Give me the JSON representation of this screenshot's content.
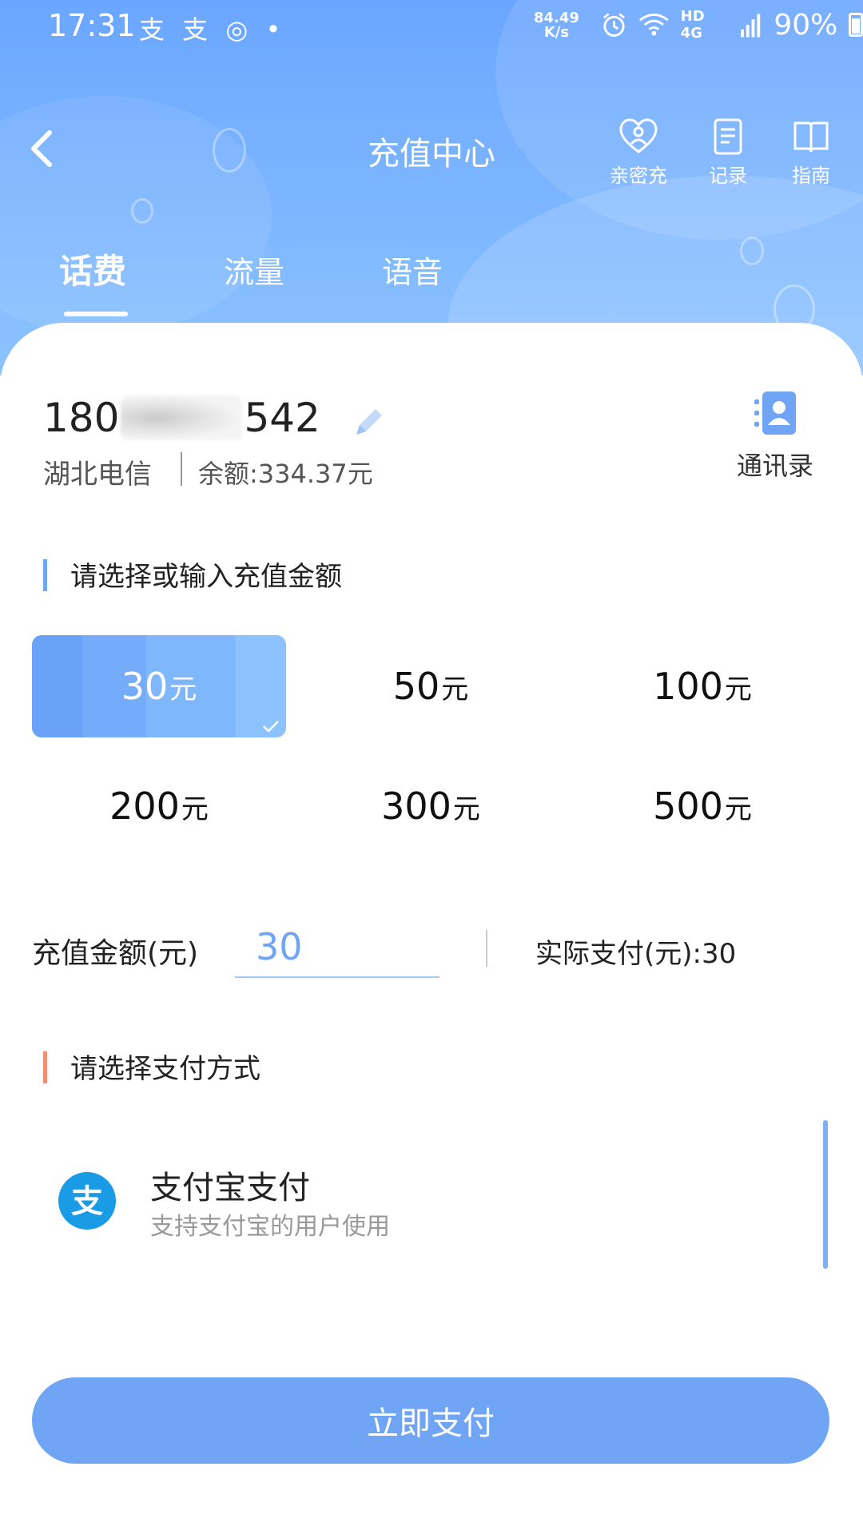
{
  "status_bar": {
    "time": "17:31",
    "app_icons": "支 支 ◎ •",
    "net_speed_value": "84.49",
    "net_speed_unit": "K/s",
    "network_label": "HD 4G",
    "battery": "90%"
  },
  "header": {
    "title": "充值中心",
    "actions": [
      {
        "label": "亲密充",
        "icon": "heart-user-icon"
      },
      {
        "label": "记录",
        "icon": "record-icon"
      },
      {
        "label": "指南",
        "icon": "book-icon"
      }
    ]
  },
  "tabs": [
    {
      "label": "话费",
      "active": true
    },
    {
      "label": "流量",
      "active": false
    },
    {
      "label": "语音",
      "active": false
    }
  ],
  "account": {
    "phone_prefix": "180",
    "phone_suffix": "542",
    "carrier": "湖北电信",
    "balance": "余额:334.37元",
    "contacts_label": "通讯录"
  },
  "amount_section": {
    "title": "请选择或输入充值金额",
    "unit": "元",
    "options": [
      {
        "value": "30",
        "selected": true
      },
      {
        "value": "50",
        "selected": false
      },
      {
        "value": "100",
        "selected": false
      },
      {
        "value": "200",
        "selected": false
      },
      {
        "value": "300",
        "selected": false
      },
      {
        "value": "500",
        "selected": false
      }
    ]
  },
  "recharge": {
    "label": "充值金额(元)",
    "value": "30",
    "actual_pay": "实际支付(元):30"
  },
  "payment_section": {
    "title": "请选择支付方式",
    "method": {
      "name": "支付宝支付",
      "desc": "支持支付宝的用户使用",
      "logo_char": "支"
    }
  },
  "pay_button": "立即支付",
  "colors": {
    "accent": "#6fa5f4",
    "section_marker_orange": "#f48c6f",
    "alipay_blue": "#1a9be6"
  }
}
